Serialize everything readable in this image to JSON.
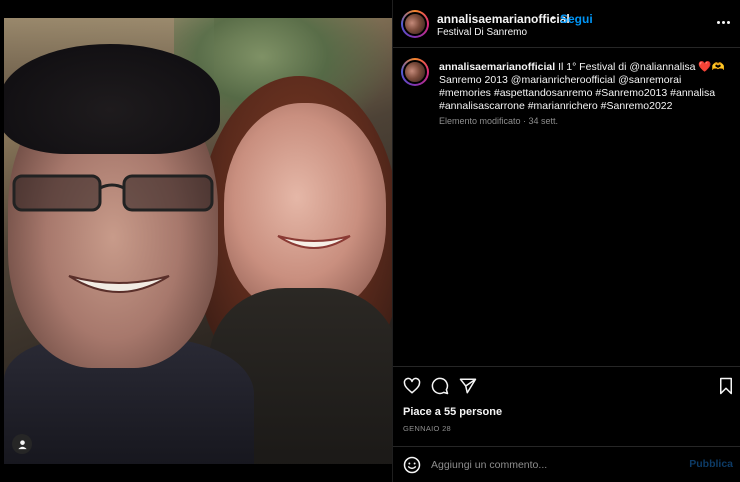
{
  "post": {
    "username": "annalisaemarianofficial",
    "separator": "•",
    "follow_label": "Segui",
    "location": "Festival Di Sanremo",
    "more_icon": "more-horizontal-icon"
  },
  "caption": {
    "username": "annalisaemarianofficial",
    "text": "Il 1° Festival di @naliannalisa ❤️🫶 Sanremo 2013 @marianricheroofficial @sanremorai #memories #aspettandosanremo #Sanremo2013 #annalisa #annalisascarrone #marianrichero #Sanremo2022",
    "meta": "Elemento modificato · 34 sett."
  },
  "actions": {
    "like_icon": "heart-icon",
    "comment_icon": "comment-icon",
    "share_icon": "send-icon",
    "save_icon": "bookmark-icon"
  },
  "likes_text": "Piace a 55 persone",
  "date_text": "GENNAIO 28",
  "comment_box": {
    "emoji_icon": "emoji-icon",
    "placeholder": "Aggiungi un commento...",
    "publish_label": "Pubblica"
  },
  "media": {
    "user_tag_icon": "user-tag-icon"
  },
  "colors": {
    "background": "#000000",
    "text": "#f5f5f5",
    "muted": "#8e8e8e",
    "accent": "#0095f6",
    "divider": "#262626"
  }
}
